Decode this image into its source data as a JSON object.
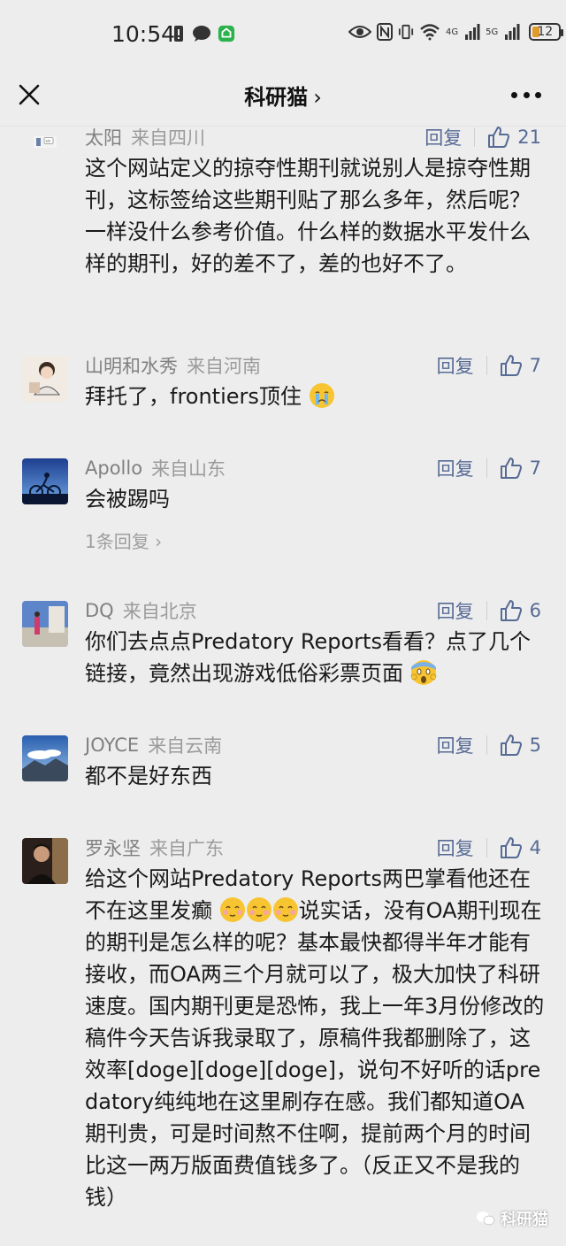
{
  "status_bar": {
    "time": "10:54",
    "net_4g": "4G",
    "net_5g": "5G",
    "battery": "12"
  },
  "nav": {
    "title": "科研猫",
    "chevron": "›"
  },
  "comments": [
    {
      "name": "太阳",
      "location": "来自四川",
      "reply_label": "回复",
      "likes": "21",
      "text": "这个网站定义的掠夺性期刊就说别人是掠夺性期刊，这标签给这些期刊贴了那么多年，然后呢？一样没什么参考价值。什么样的数据水平发什么样的期刊，好的差不了，差的也好不了。"
    },
    {
      "name": "山明和水秀",
      "location": "来自河南",
      "reply_label": "回复",
      "likes": "7",
      "text": "拜托了，frontiers顶住"
    },
    {
      "name": "Apollo",
      "location": "来自山东",
      "reply_label": "回复",
      "likes": "7",
      "text": "会被踢吗",
      "sub_replies": "1条回复 ›"
    },
    {
      "name": "DQ",
      "location": "来自北京",
      "reply_label": "回复",
      "likes": "6",
      "text": "你们去点点Predatory Reports看看？点了几个链接，竟然出现游戏低俗彩票页面"
    },
    {
      "name": "JOYCE",
      "location": "来自云南",
      "reply_label": "回复",
      "likes": "5",
      "text": "都不是好东西"
    },
    {
      "name": "罗永坚",
      "location": "来自广东",
      "reply_label": "回复",
      "likes": "4",
      "text_a": "给这个网站Predatory Reports两巴掌看他还在不在这里发癫",
      "text_b": "说实话，没有OA期刊现在的期刊是怎么样的呢？基本最快都得半年才能有接收，而OA两三个月就可以了，极大加快了科研速度。国内期刊更是恐怖，我上一年3月份修改的稿件今天告诉我录取了，原稿件我都删除了，这效率[doge][doge][doge]，说句不好听的话predatory纯纯地在这里刷存在感。我们都知道OA期刊贵，可是时间熬不住啊，提前两个月的时间比这一两万版面费值钱多了。（反正又不是我的钱）"
    }
  ],
  "watermark": "科研猫",
  "colors": {
    "background": "#ededed",
    "link": "#576b95",
    "meta_text": "#9b9b9b"
  }
}
